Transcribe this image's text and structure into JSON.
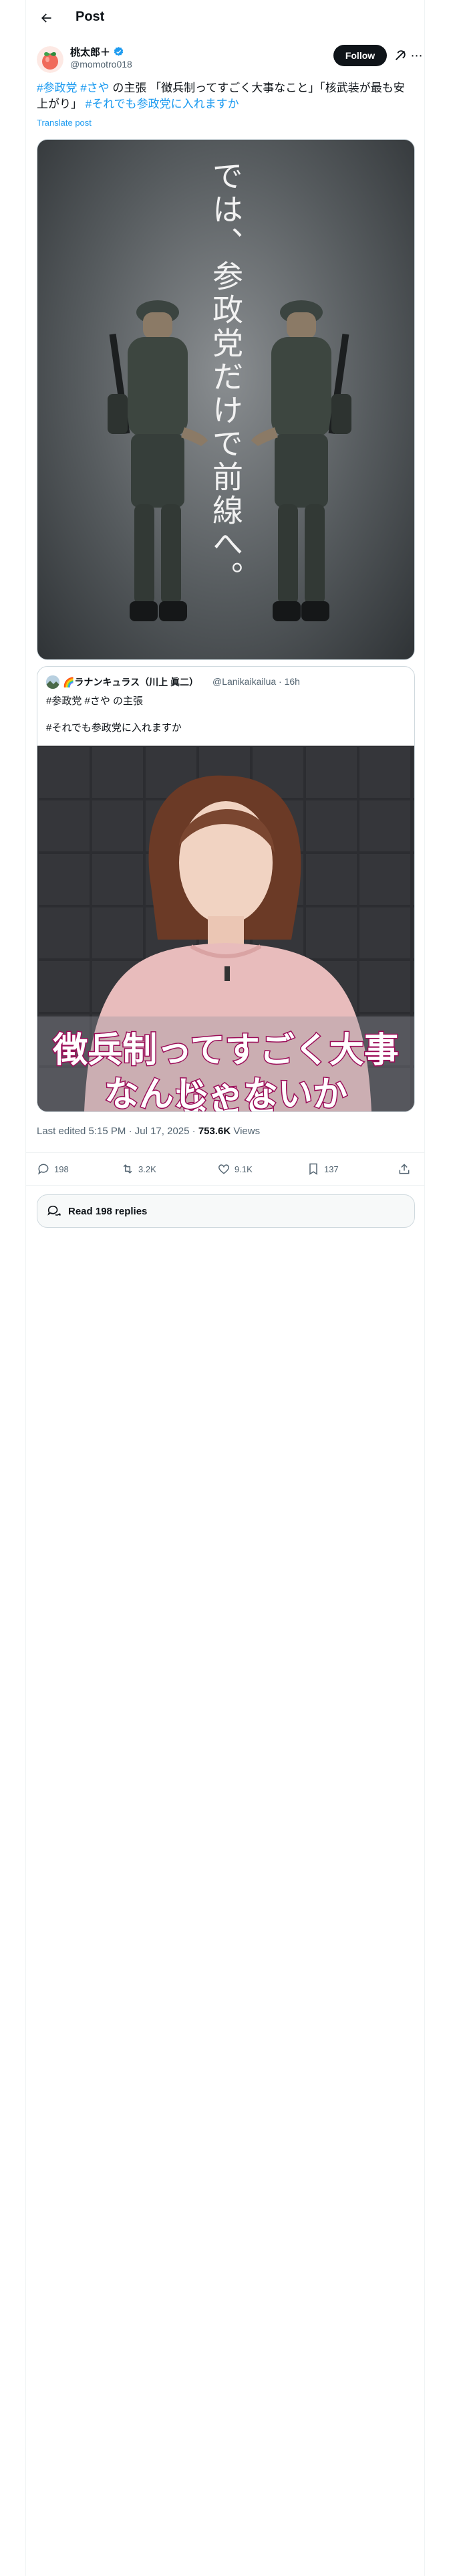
{
  "header": {
    "title": "Post"
  },
  "post": {
    "author_name": "桃太郎＋",
    "author_handle": "@momotro018",
    "follow_label": "Follow",
    "text_parts": [
      "#参政党",
      "#さや",
      " の主張 「徴兵制ってすごく大事なこと」「核武装が最も安上がり」 ",
      "#それでも参政党に入れますか"
    ],
    "translate_label": "Translate post",
    "media_overlay_text": "では、参政党だけで前線へ。",
    "edited_label": "Last edited 5:15 PM · Jul 17, 2025 · ",
    "views_count": "753.6K",
    "views_label": " Views"
  },
  "quote": {
    "author_name": "🌈ラナンキュラス（川上 眞二）",
    "author_handle": "@Lanikaikailua · 16h",
    "line1": "#参政党 #さや の主張",
    "line2": "#それでも参政党に入れますか",
    "caption_line1": "徴兵制ってすごく大事なこと",
    "caption_line2": "なんじゃないか"
  },
  "actions": {
    "replies": "198",
    "reposts": "3.2K",
    "likes": "9.1K",
    "bookmarks": "137"
  },
  "read_replies_label": "Read 198 replies",
  "colors": {
    "accent": "#1d9bf0",
    "text": "#0f1419",
    "muted": "#536471",
    "caption_stroke": "#9c0d59"
  }
}
